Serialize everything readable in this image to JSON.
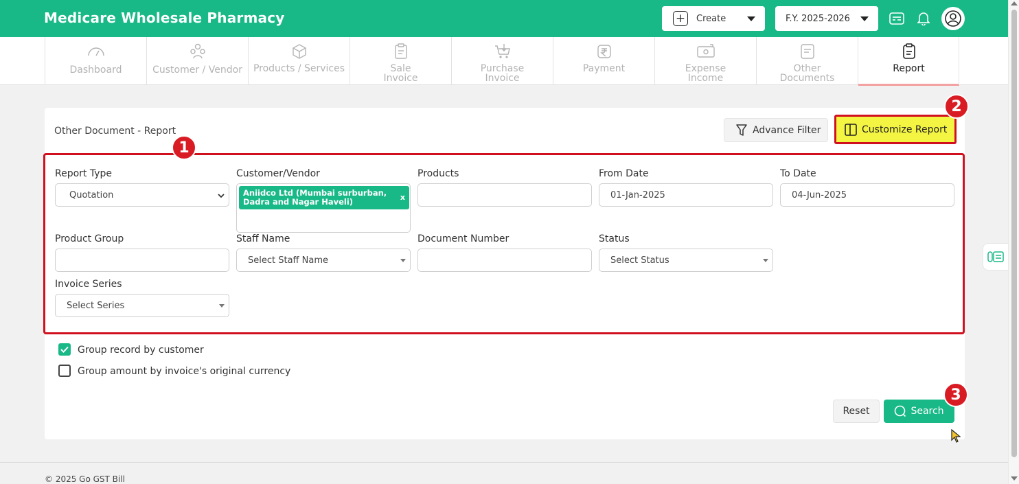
{
  "header": {
    "brand": "Medicare Wholesale Pharmacy",
    "create_label": "Create",
    "fy_label": "F.Y. 2025-2026"
  },
  "nav": {
    "tabs": [
      {
        "label": "Dashboard",
        "icon": "gauge-icon",
        "active": false
      },
      {
        "label": "Customer / Vendor",
        "icon": "users-icon",
        "active": false
      },
      {
        "label": "Products / Services",
        "icon": "box-icon",
        "active": false
      },
      {
        "label": "Sale Invoice",
        "icon": "clipboard-icon",
        "active": false
      },
      {
        "label": "Purchase Invoice",
        "icon": "cart-icon",
        "active": false
      },
      {
        "label": "Payment",
        "icon": "rupee-icon",
        "active": false
      },
      {
        "label": "Expense Income",
        "icon": "money-icon",
        "active": false
      },
      {
        "label": "Other Documents",
        "icon": "document-icon",
        "active": false
      },
      {
        "label": "Report",
        "icon": "report-icon",
        "active": true
      }
    ]
  },
  "report": {
    "title": "Other Document - Report",
    "advance_filter_label": "Advance Filter",
    "customize_report_label": "Customize Report",
    "fields": {
      "report_type_label": "Report Type",
      "report_type_value": "Quotation",
      "customer_vendor_label": "Customer/Vendor",
      "customer_tag": "Aniidco Ltd (Mumbai surburban, Dadra and Nagar Haveli)",
      "customer_tag_remove": "x",
      "products_label": "Products",
      "products_value": "",
      "from_date_label": "From Date",
      "from_date_value": "01-Jan-2025",
      "to_date_label": "To Date",
      "to_date_value": "04-Jun-2025",
      "product_group_label": "Product Group",
      "product_group_value": "",
      "staff_name_label": "Staff Name",
      "staff_name_placeholder": "Select Staff Name",
      "document_number_label": "Document Number",
      "document_number_value": "",
      "status_label": "Status",
      "status_placeholder": "Select Status",
      "invoice_series_label": "Invoice Series",
      "invoice_series_placeholder": "Select Series"
    },
    "options": {
      "group_by_customer_label": "Group record by customer",
      "group_by_customer_checked": true,
      "group_by_currency_label": "Group amount by invoice's original currency",
      "group_by_currency_checked": false
    },
    "reset_label": "Reset",
    "search_label": "Search"
  },
  "annotations": {
    "badge_1": "1",
    "badge_2": "2",
    "badge_3": "3",
    "highlight_color": "#d0101f",
    "badge_color": "#d91c23"
  },
  "footer": {
    "copyright": "© 2025 Go GST Bill"
  },
  "colors": {
    "brand_green": "#19b987",
    "customize_bg": "#f4f542"
  }
}
